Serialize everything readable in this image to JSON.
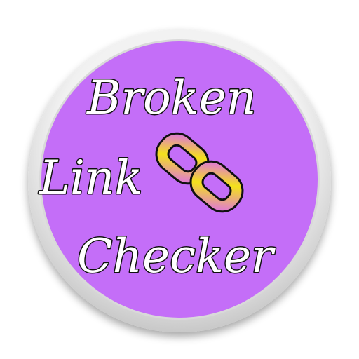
{
  "app_icon": {
    "line1": "Broken",
    "line2": "Link",
    "line3": "Checker",
    "icon": "chain-link-icon",
    "colors": {
      "background": "#c46ef8",
      "ring_light": "#f4f4f4",
      "ring_dark": "#bdbdbd",
      "text_fill": "#ffffff",
      "text_outline": "#111111",
      "chain_yellow": "#f4e21a",
      "chain_pink": "#e07bd2"
    }
  }
}
